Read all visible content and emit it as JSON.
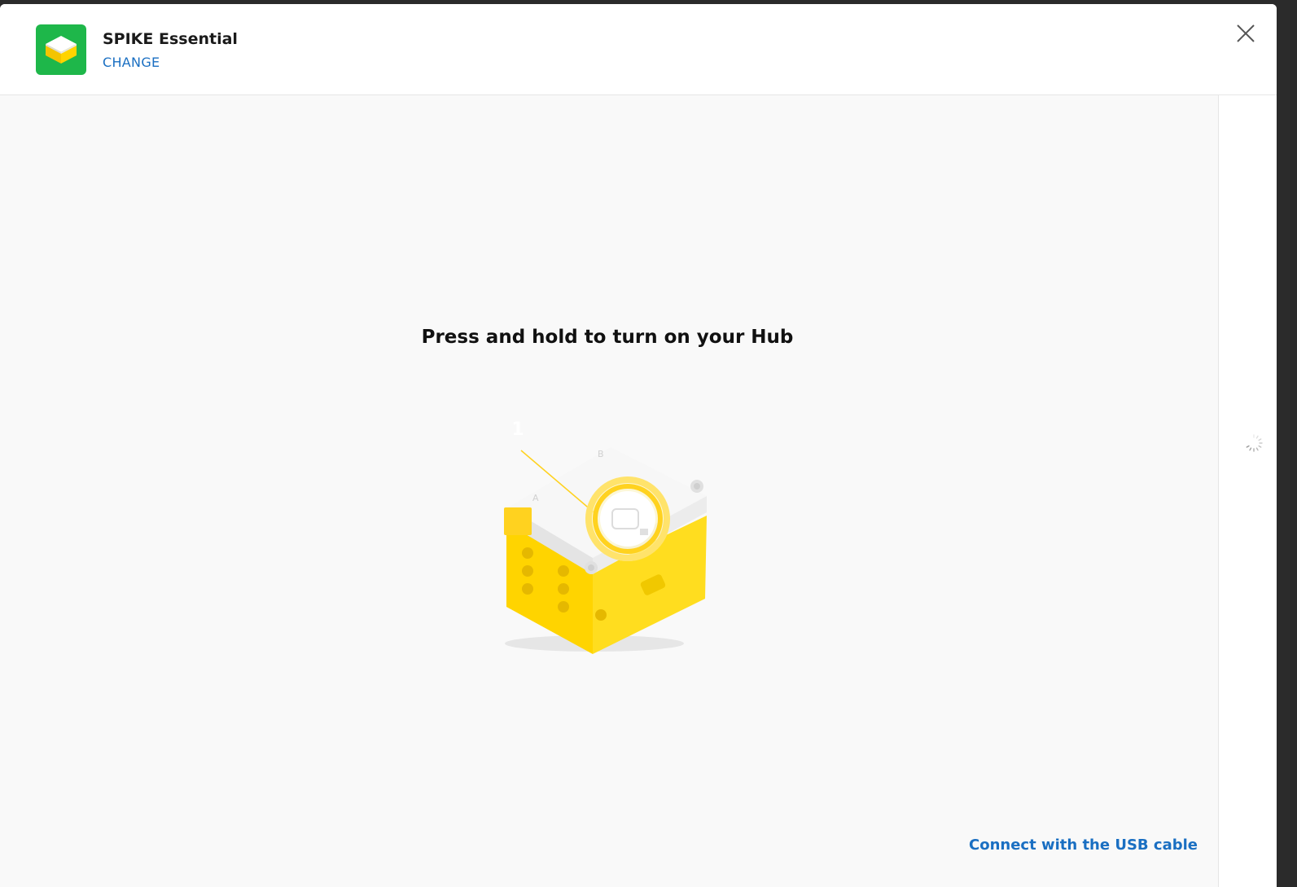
{
  "header": {
    "hub_name": "SPIKE Essential",
    "change_label": "CHANGE",
    "thumb_icon": "hub-thumbnail-icon",
    "close_icon": "close-icon"
  },
  "main": {
    "instruction": "Press and hold to turn on your Hub",
    "step_badge": "1",
    "usb_link": "Connect with the USB cable"
  },
  "colors": {
    "brand_green": "#1eb74a",
    "link_blue": "#1a6fc2",
    "hub_yellow": "#ffd400",
    "badge_yellow": "#ffd21f"
  }
}
